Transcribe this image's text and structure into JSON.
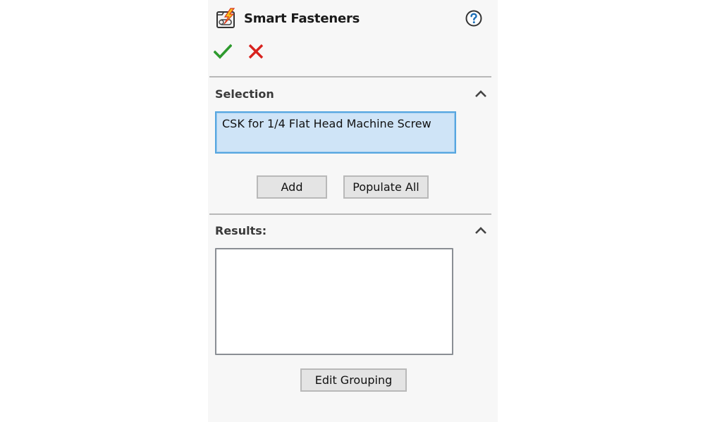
{
  "panel": {
    "title": "Smart Fasteners",
    "icons": {
      "feature": "smart-fasteners-icon",
      "help": "help-icon",
      "ok": "checkmark-icon",
      "cancel": "close-icon"
    }
  },
  "selection": {
    "title": "Selection",
    "items": [
      "CSK for 1/4 Flat Head Machine Screw"
    ],
    "add_label": "Add",
    "populate_all_label": "Populate All",
    "collapse_icon": "chevron-up-icon"
  },
  "results": {
    "title": "Results:",
    "items": [],
    "edit_grouping_label": "Edit Grouping",
    "collapse_icon": "chevron-up-icon"
  },
  "colors": {
    "panel_bg": "#f7f7f7",
    "selection_bg": "#cfe4f7",
    "selection_border": "#56a6e0",
    "ok_green": "#2e9a2e",
    "cancel_red": "#d8221e",
    "help_blue": "#1c6fb8"
  }
}
